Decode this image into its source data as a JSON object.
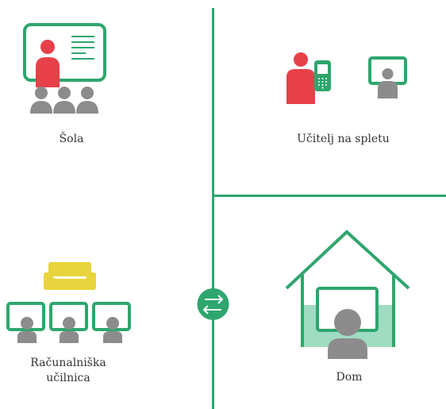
{
  "labels": {
    "sola": "Šola",
    "ucitelj": "Učitelj na spletu",
    "racunalniska_line1": "Računalniška",
    "racunalniska_line2": "učilnica",
    "dom": "Dom"
  },
  "colors": {
    "green": "#2ea66e",
    "red": "#e8404a",
    "gray": "#8c8c8c",
    "yellow": "#e8d43c",
    "light_green": "#9fdcc2",
    "text": "#333333"
  },
  "icons": [
    "school-icon",
    "online-teacher-icon",
    "computer-lab-icon",
    "home-icon",
    "swap-arrows-icon"
  ]
}
